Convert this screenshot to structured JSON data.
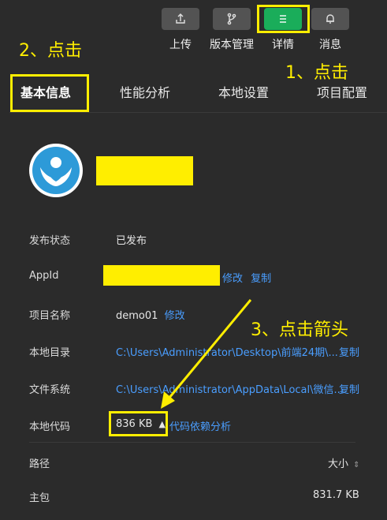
{
  "toolbar": {
    "upload_label": "上传",
    "version_label": "版本管理",
    "details_label": "详情",
    "messages_label": "消息"
  },
  "tabs": [
    "基本信息",
    "性能分析",
    "本地设置",
    "项目配置"
  ],
  "annotations": {
    "step1": "1、点击",
    "step2": "2、点击",
    "step3": "3、点击箭头"
  },
  "info": {
    "publish_status_label": "发布状态",
    "publish_status_value": "已发布",
    "appid_label": "AppId",
    "appid_edit": "修改",
    "appid_copy": "复制",
    "project_name_label": "项目名称",
    "project_name_value": "demo01",
    "project_name_edit": "修改",
    "local_dir_label": "本地目录",
    "local_dir_value": "C:\\Users\\Administrator\\Desktop\\前端24期\\...",
    "local_dir_copy": "复制",
    "filesystem_label": "文件系统",
    "filesystem_value": "C:\\Users\\Administrator\\AppData\\Local\\微信...",
    "filesystem_copy": "复制",
    "local_code_label": "本地代码",
    "local_code_size": "836 KB",
    "dependency_analysis": "代码依赖分析"
  },
  "code_table": {
    "path_header": "路径",
    "size_header": "大小",
    "rows": [
      {
        "name": "主包",
        "size": "831.7 KB"
      }
    ]
  },
  "colors": {
    "accent": "#1aad5a",
    "link": "#4a9eff",
    "highlight": "#ffee00",
    "background": "#2b2b2b"
  }
}
